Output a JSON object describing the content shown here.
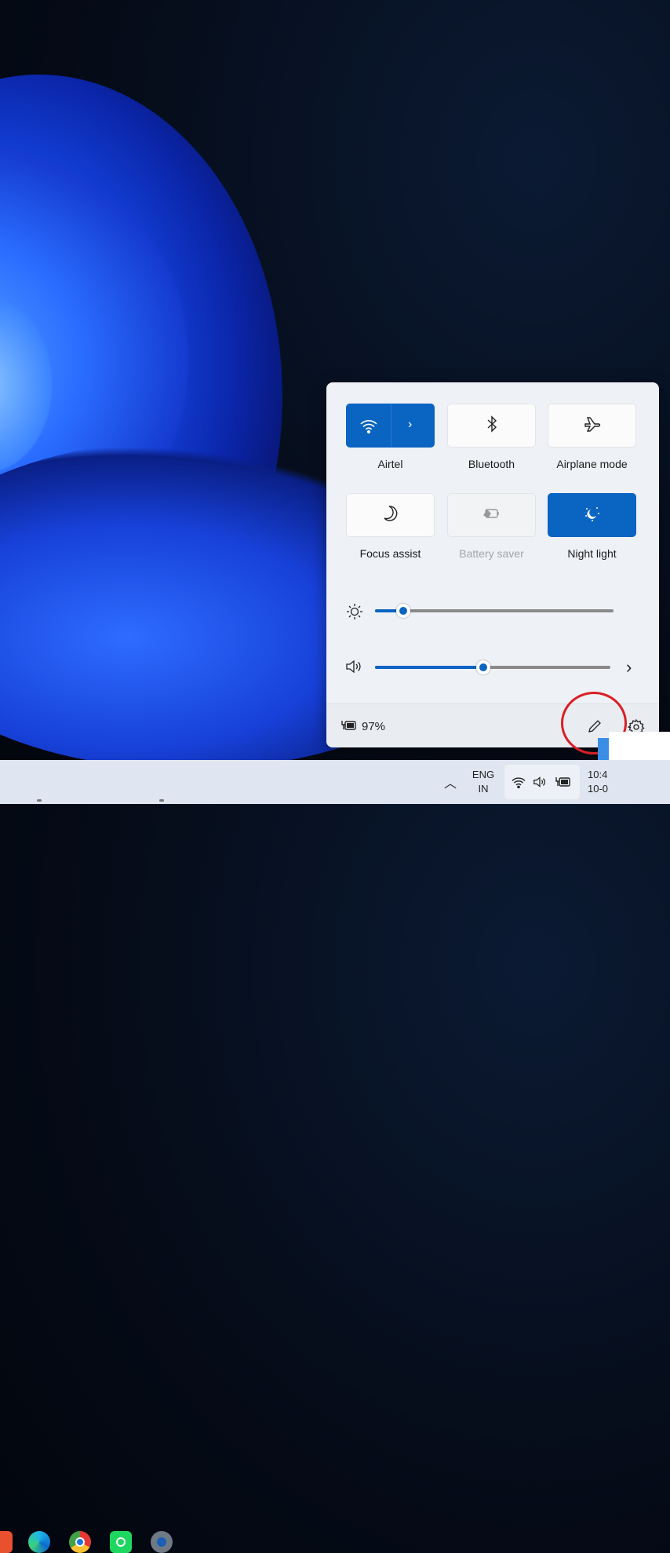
{
  "quick_settings": {
    "tiles": [
      {
        "label": "Airtel",
        "icon": "wifi-icon",
        "state": "on"
      },
      {
        "label": "Bluetooth",
        "icon": "bluetooth-icon",
        "state": "off"
      },
      {
        "label": "Airplane mode",
        "icon": "airplane-icon",
        "state": "off"
      },
      {
        "label": "Focus assist",
        "icon": "moon-icon",
        "state": "off"
      },
      {
        "label": "Battery saver",
        "icon": "battery-saver-icon",
        "state": "disabled"
      },
      {
        "label": "Night light",
        "icon": "night-light-icon",
        "state": "on"
      }
    ],
    "brightness_percent": 12,
    "volume_percent": 46,
    "battery_text": "97%",
    "accent_color": "#0a64c2"
  },
  "taskbar": {
    "apps": [
      "Brave",
      "Microsoft Edge",
      "Google Chrome",
      "Spotify",
      "Settings"
    ],
    "language_line1": "ENG",
    "language_line2": "IN",
    "time_partial": "10:4",
    "date_partial": "10-0"
  }
}
